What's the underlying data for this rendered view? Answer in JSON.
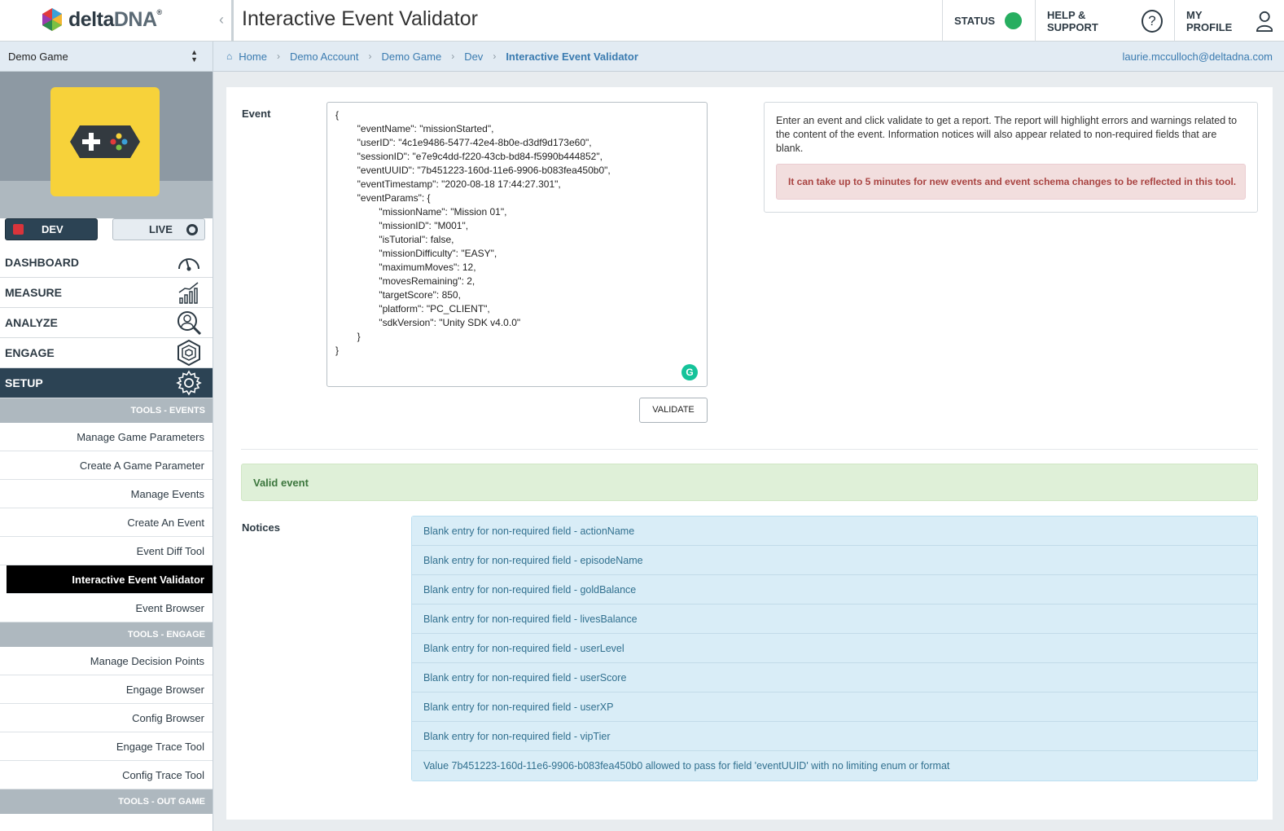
{
  "app": {
    "logo_main": "delta",
    "logo_accent": "DNA",
    "logo_mark": "®",
    "page_title": "Interactive Event Validator"
  },
  "topnav": {
    "status_label": "STATUS",
    "status_color": "#27ae60",
    "help_label": "HELP & SUPPORT",
    "help_icon": "?",
    "profile_label": "MY PROFILE"
  },
  "game_selector": {
    "value": "Demo Game"
  },
  "breadcrumb": {
    "items": [
      "Home",
      "Demo Account",
      "Demo Game",
      "Dev",
      "Interactive Event Validator"
    ],
    "user_email": "laurie.mcculloch@deltadna.com"
  },
  "env": {
    "dev_label": "DEV",
    "live_label": "LIVE",
    "active": "DEV"
  },
  "menu": {
    "items": [
      {
        "label": "DASHBOARD",
        "icon": "gauge-icon"
      },
      {
        "label": "MEASURE",
        "icon": "chart-icon"
      },
      {
        "label": "ANALYZE",
        "icon": "magnifier-person-icon"
      },
      {
        "label": "ENGAGE",
        "icon": "hexagon-icon"
      },
      {
        "label": "SETUP",
        "icon": "gear-icon"
      }
    ],
    "active": "SETUP"
  },
  "tools_events": {
    "heading": "TOOLS - EVENTS",
    "items": [
      "Manage Game Parameters",
      "Create A Game Parameter",
      "Manage Events",
      "Create An Event",
      "Event Diff Tool",
      "Interactive Event Validator",
      "Event Browser"
    ],
    "selected": "Interactive Event Validator"
  },
  "tools_engage": {
    "heading": "TOOLS - ENGAGE",
    "items": [
      "Manage Decision Points",
      "Engage Browser",
      "Config Browser",
      "Engage Trace Tool",
      "Config Trace Tool"
    ]
  },
  "tools_outgame": {
    "heading": "TOOLS - OUT GAME"
  },
  "validator": {
    "event_label": "Event",
    "event_json": "{\n        \"eventName\": \"missionStarted\",\n        \"userID\": \"4c1e9486-5477-42e4-8b0e-d3df9d173e60\",\n        \"sessionID\": \"e7e9c4dd-f220-43cb-bd84-f5990b444852\",\n        \"eventUUID\": \"7b451223-160d-11e6-9906-b083fea450b0\",\n        \"eventTimestamp\": \"2020-08-18 17:44:27.301\",\n        \"eventParams\": {\n                \"missionName\": \"Mission 01\",\n                \"missionID\": \"M001\",\n                \"isTutorial\": false,\n                \"missionDifficulty\": \"EASY\",\n                \"maximumMoves\": 12,\n                \"movesRemaining\": 2,\n                \"targetScore\": 850,\n                \"platform\": \"PC_CLIENT\",\n                \"sdkVersion\": \"Unity SDK v4.0.0\"\n        }\n}",
    "grammarly_badge": "G",
    "validate_label": "VALIDATE",
    "info_text": "Enter an event and click validate to get a report. The report will highlight errors and warnings related to the content of the event. Information notices will also appear related to non-required fields that are blank.",
    "warning_text": "It can take up to 5 minutes for new events and event schema changes to be reflected in this tool.",
    "result_text": "Valid event",
    "notices_label": "Notices",
    "notices": [
      "Blank entry for non-required field - actionName",
      "Blank entry for non-required field - episodeName",
      "Blank entry for non-required field - goldBalance",
      "Blank entry for non-required field - livesBalance",
      "Blank entry for non-required field - userLevel",
      "Blank entry for non-required field - userScore",
      "Blank entry for non-required field - userXP",
      "Blank entry for non-required field - vipTier",
      "Value 7b451223-160d-11e6-9906-b083fea450b0 allowed to pass for field 'eventUUID' with no limiting enum or format"
    ]
  }
}
